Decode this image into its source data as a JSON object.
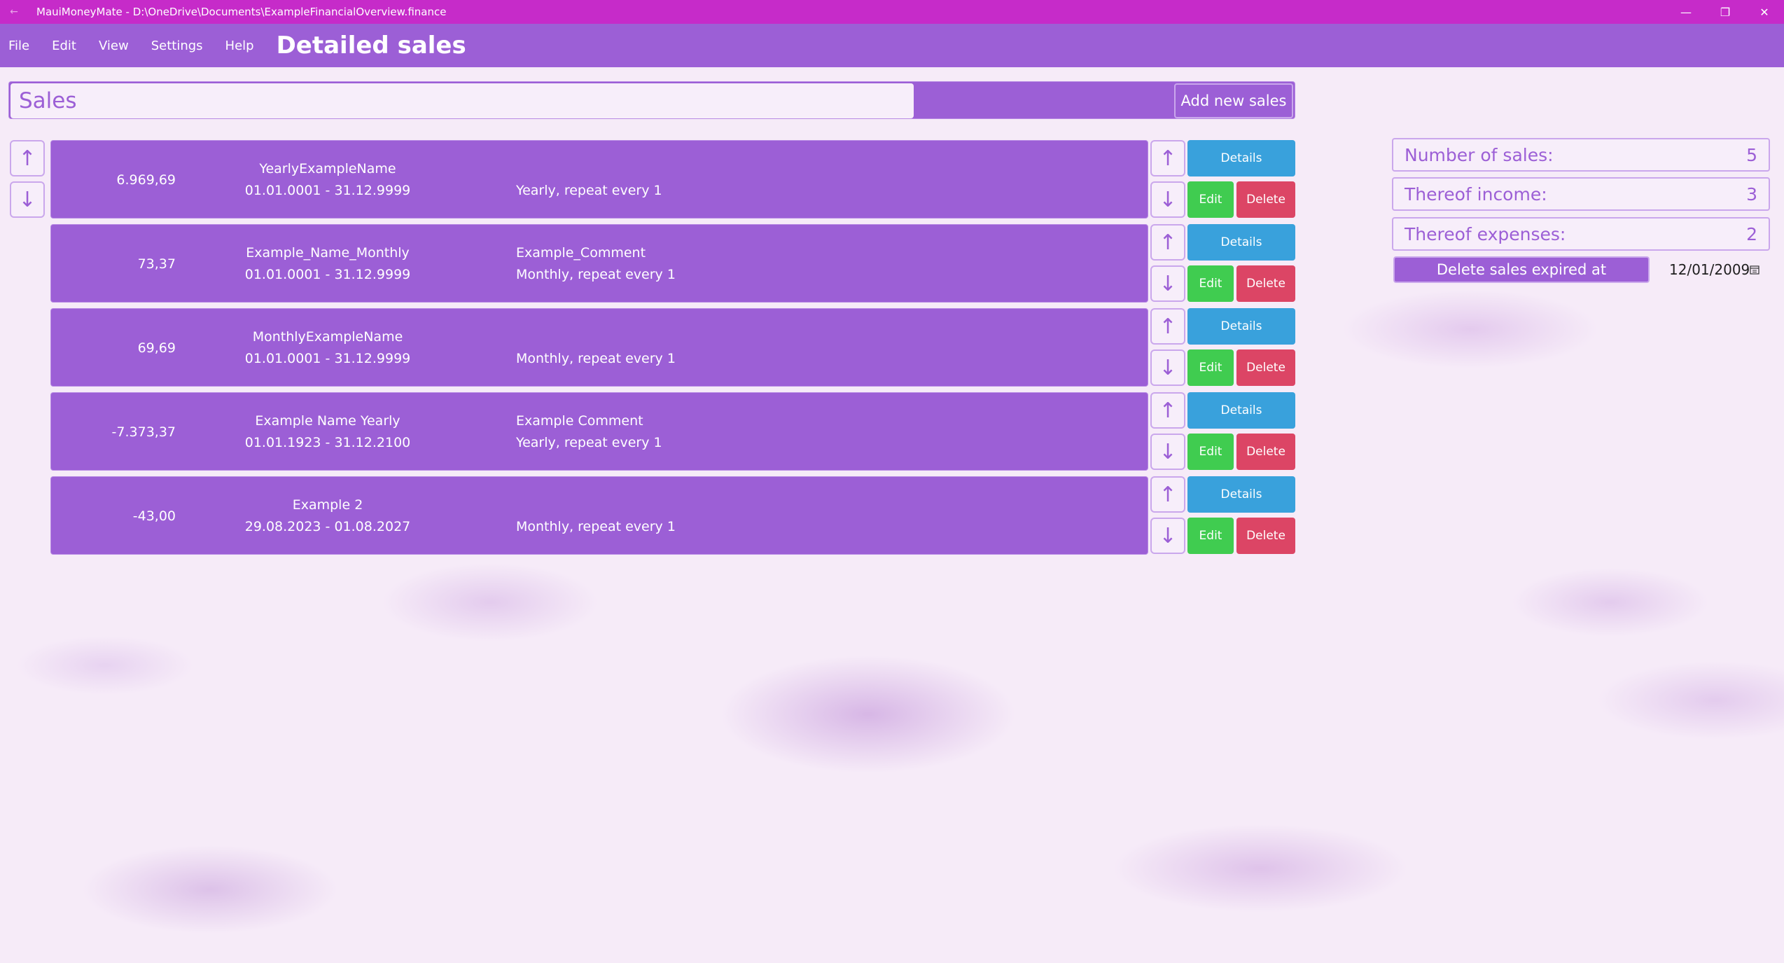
{
  "window": {
    "title": "MauiMoneyMate - D:\\OneDrive\\Documents\\ExampleFinancialOverview.finance",
    "back_icon": "back-arrow-icon",
    "minimize_glyph": "—",
    "restore_glyph": "❐",
    "close_glyph": "✕"
  },
  "menu": {
    "items": [
      "File",
      "Edit",
      "View",
      "Settings",
      "Help"
    ],
    "page_title": "Detailed sales"
  },
  "sales": {
    "header_title": "Sales",
    "add_button": "Add new sales",
    "up_glyph": "↑",
    "down_glyph": "↓",
    "details_label": "Details",
    "edit_label": "Edit",
    "delete_label": "Delete",
    "rows": [
      {
        "amount": "6.969,69",
        "name": "YearlyExampleName",
        "dates": "01.01.0001 - 31.12.9999",
        "comment": "",
        "recurrence": "Yearly, repeat every 1"
      },
      {
        "amount": "73,37",
        "name": "Example_Name_Monthly",
        "dates": "01.01.0001 - 31.12.9999",
        "comment": "Example_Comment",
        "recurrence": "Monthly, repeat every 1"
      },
      {
        "amount": "69,69",
        "name": "MonthlyExampleName",
        "dates": "01.01.0001 - 31.12.9999",
        "comment": "",
        "recurrence": "Monthly, repeat every 1"
      },
      {
        "amount": "-7.373,37",
        "name": "Example Name Yearly",
        "dates": "01.01.1923 - 31.12.2100",
        "comment": "Example Comment",
        "recurrence": "Yearly, repeat every 1"
      },
      {
        "amount": "-43,00",
        "name": "Example 2",
        "dates": "29.08.2023 - 01.08.2027",
        "comment": "",
        "recurrence": "Monthly, repeat every 1"
      }
    ]
  },
  "stats": {
    "number_label": "Number of sales:",
    "number_value": "5",
    "income_label": "Thereof income:",
    "income_value": "3",
    "expenses_label": "Thereof expenses:",
    "expenses_value": "2",
    "delete_expired_label": "Delete sales expired at",
    "expiry_date": "12/01/2009",
    "calendar_icon": "calendar-icon"
  },
  "colors": {
    "titlebar": "#c62bc9",
    "accent": "#9c5fd6",
    "details": "#39a1dc",
    "edit": "#40cc50",
    "delete": "#dc4565"
  }
}
